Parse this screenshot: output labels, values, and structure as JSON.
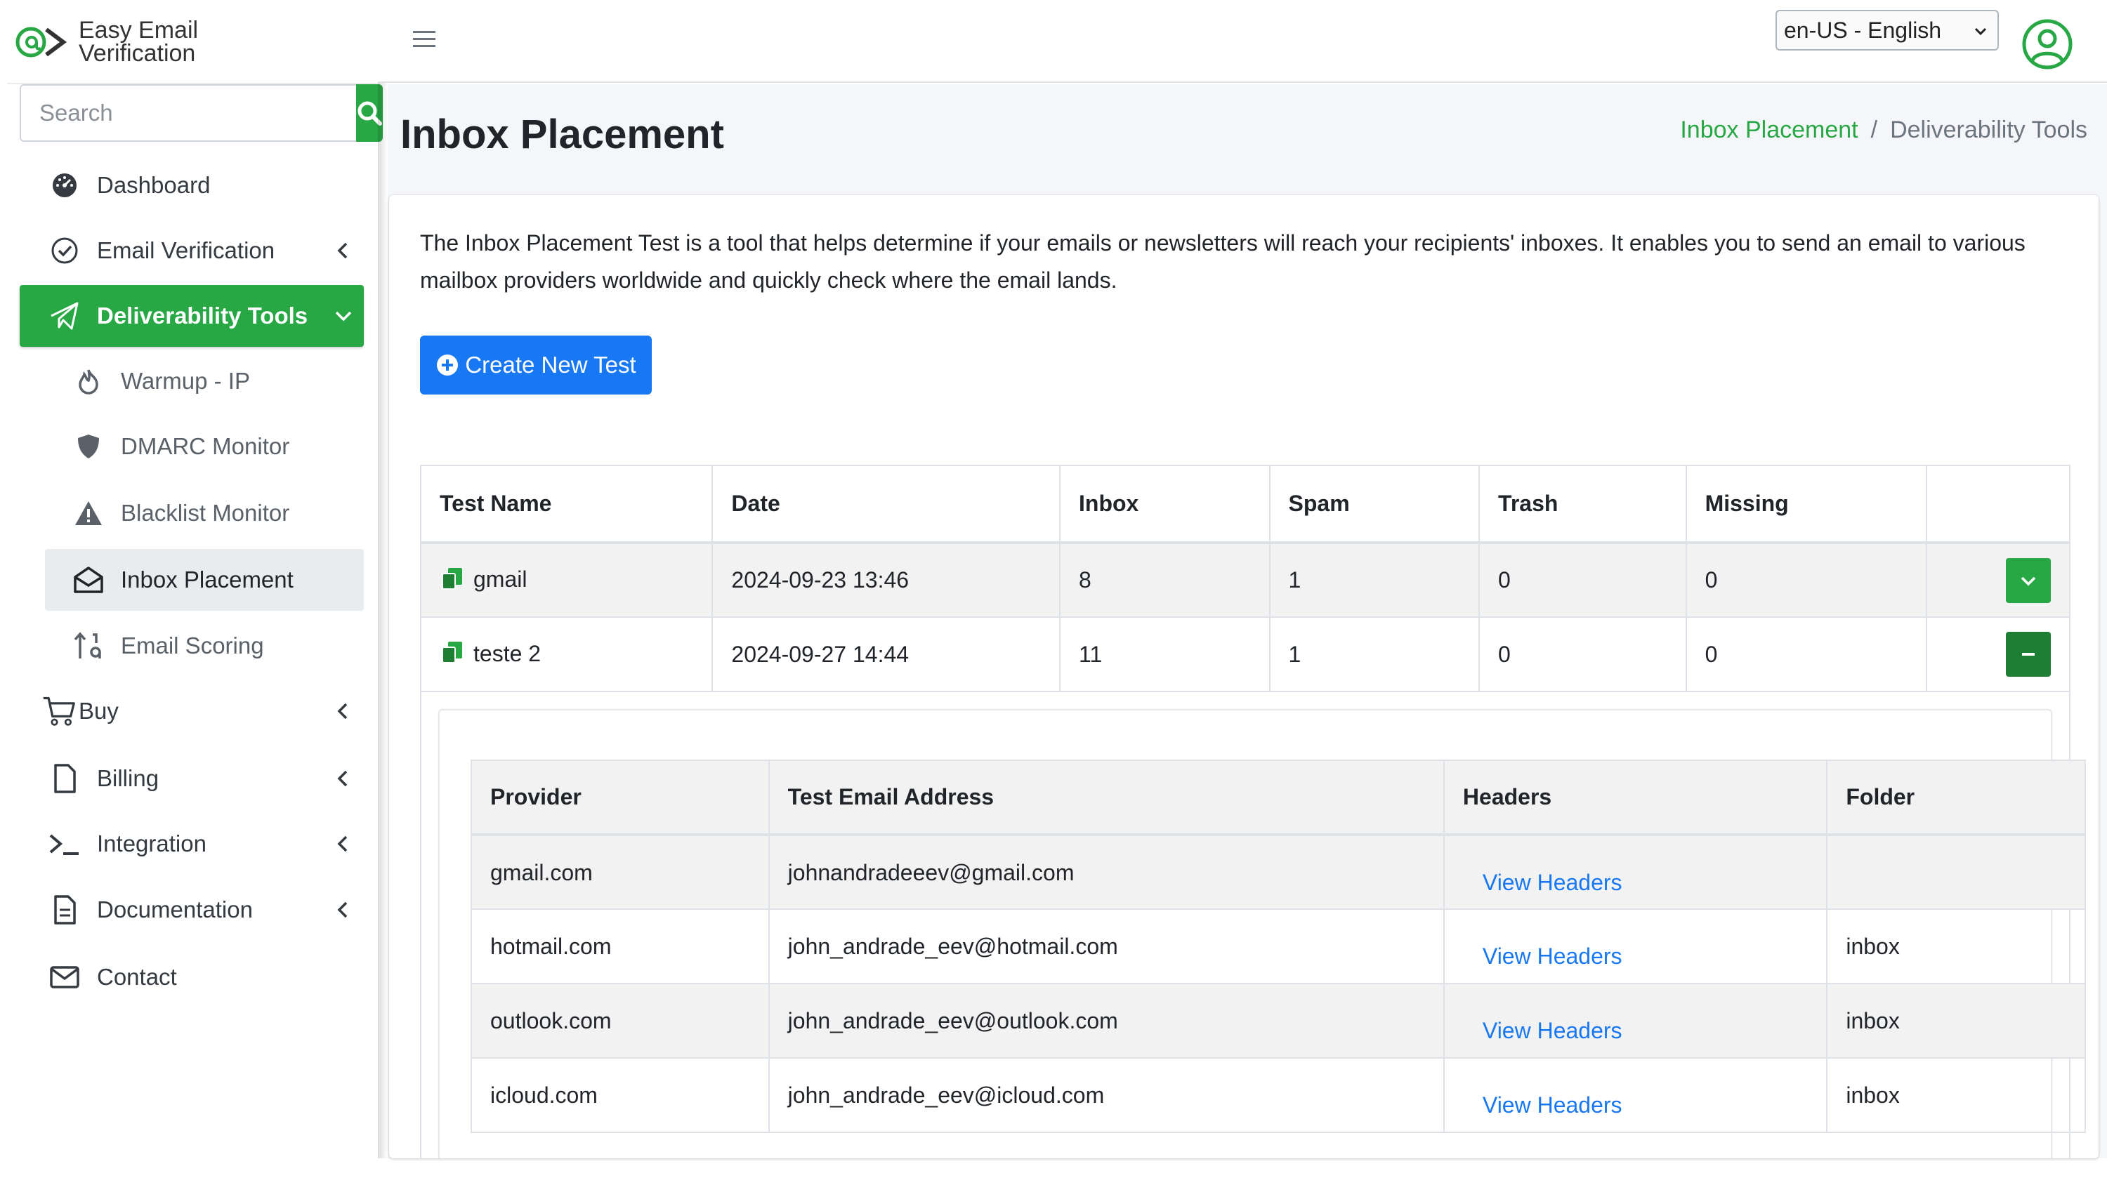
{
  "brand": {
    "line1": "Easy Email",
    "line2": "Verification",
    "accent": "#28a745"
  },
  "search": {
    "placeholder": "Search"
  },
  "sidebar": {
    "items": [
      {
        "label": "Dashboard",
        "icon": "dashboard-icon"
      },
      {
        "label": "Email Verification",
        "icon": "check-circle-icon"
      },
      {
        "label": "Deliverability Tools",
        "icon": "paper-plane-icon"
      },
      {
        "label": "Buy",
        "icon": "cart-icon"
      },
      {
        "label": "Billing",
        "icon": "file-icon"
      },
      {
        "label": "Integration",
        "icon": "terminal-icon"
      },
      {
        "label": "Documentation",
        "icon": "document-icon"
      },
      {
        "label": "Contact",
        "icon": "envelope-icon"
      }
    ],
    "subitems": [
      {
        "label": "Warmup - IP",
        "icon": "fire-icon"
      },
      {
        "label": "DMARC Monitor",
        "icon": "shield-icon"
      },
      {
        "label": "Blacklist Monitor",
        "icon": "warning-icon"
      },
      {
        "label": "Inbox Placement",
        "icon": "envelope-open-icon"
      },
      {
        "label": "Email Scoring",
        "icon": "sort-numeric-icon"
      }
    ]
  },
  "topbar": {
    "language": "en-US - English"
  },
  "page": {
    "title": "Inbox Placement",
    "breadcrumb": {
      "link": "Inbox Placement",
      "separator": "/",
      "current": "Deliverability Tools"
    },
    "intro": "The Inbox Placement Test is a tool that helps determine if your emails or newsletters will reach your recipients' inboxes. It enables you to send an email to various mailbox providers worldwide and quickly check where the email lands.",
    "create_button": "Create New Test"
  },
  "tests_table": {
    "headers": [
      "Test Name",
      "Date",
      "Inbox",
      "Spam",
      "Trash",
      "Missing"
    ],
    "rows": [
      {
        "name": "gmail",
        "date": "2024-09-23 13:46",
        "inbox": "8",
        "spam": "1",
        "trash": "0",
        "missing": "0"
      },
      {
        "name": "teste 2",
        "date": "2024-09-27 14:44",
        "inbox": "11",
        "spam": "1",
        "trash": "0",
        "missing": "0"
      }
    ]
  },
  "providers_table": {
    "headers": [
      "Provider",
      "Test Email Address",
      "Headers",
      "Folder"
    ],
    "link_label": "View Headers",
    "rows": [
      {
        "provider": "gmail.com",
        "email": "johnandradeeev@gmail.com",
        "folder": ""
      },
      {
        "provider": "hotmail.com",
        "email": "john_andrade_eev@hotmail.com",
        "folder": "inbox"
      },
      {
        "provider": "outlook.com",
        "email": "john_andrade_eev@outlook.com",
        "folder": "inbox"
      },
      {
        "provider": "icloud.com",
        "email": "john_andrade_eev@icloud.com",
        "folder": "inbox"
      }
    ]
  },
  "colors": {
    "primary": "#1877f2",
    "success": "#28a745",
    "success_dark": "#1e7e34"
  }
}
